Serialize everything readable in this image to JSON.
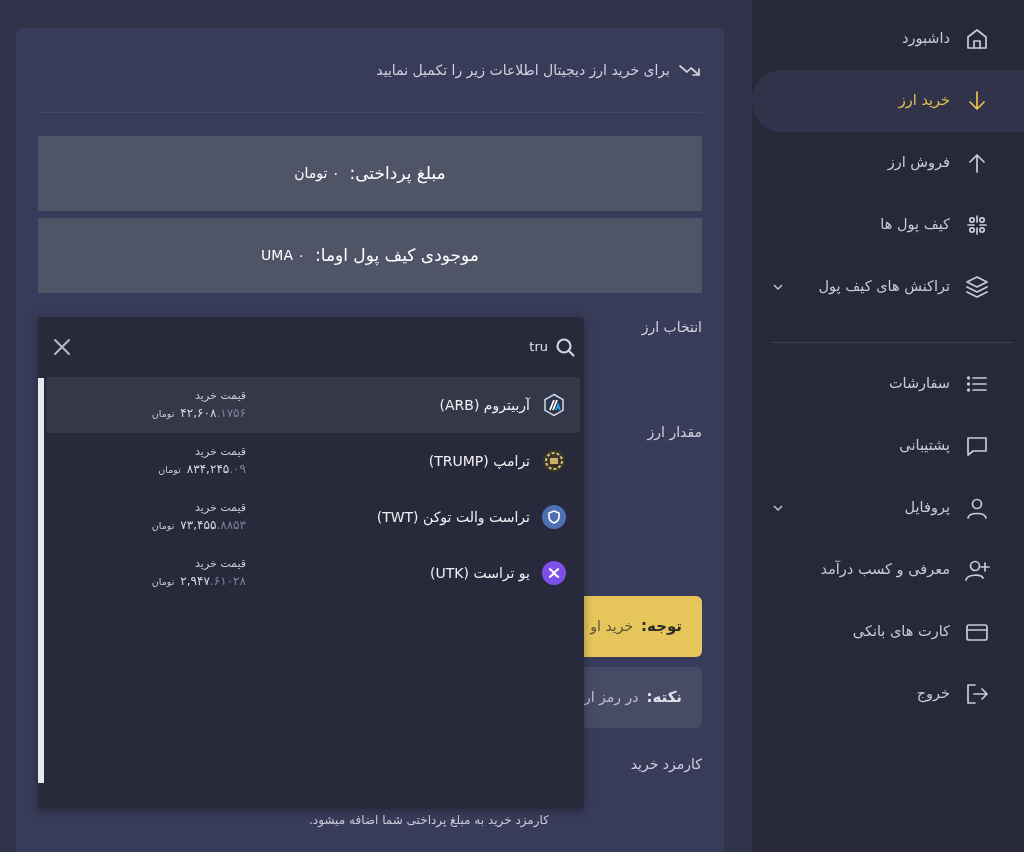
{
  "header": {
    "text": "برای خرید ارز دیجیتال اطلاعات زیر را تکمیل نمایید"
  },
  "summary": [
    {
      "label": "مبلغ پرداختی:",
      "value": "۰ تومان"
    },
    {
      "label": "موجودی کیف پول اوما:",
      "value": "۰ UMA"
    }
  ],
  "form": {
    "currency_label": "انتخاب ارز",
    "amount_label": "مقدار ارز",
    "alerts": [
      {
        "kind": "warning",
        "title": "توجه:",
        "text": "خرید او"
      },
      {
        "kind": "note",
        "title": "نکته:",
        "text": "در رمز ار"
      }
    ],
    "fee_label": "کارمزد خرید",
    "fee_hint": "کارمزد خرید به مبلغ پرداختی شما اضافه میشود."
  },
  "dropdown": {
    "search_value": "tru",
    "items": [
      {
        "name": "آربیتروم (ARB)",
        "price_label": "قیمت خرید",
        "price_int": "۴۲,۶۰۸",
        "price_frac": ".۱۷۵۶",
        "unit": "تومان",
        "selected": true
      },
      {
        "name": "ترامپ (TRUMP)",
        "price_label": "قیمت خرید",
        "price_int": "۸۳۴,۲۴۵",
        "price_frac": ".۰۹",
        "unit": "تومان",
        "selected": false
      },
      {
        "name": "تراست والت توکن (TWT)",
        "price_label": "قیمت خرید",
        "price_int": "۷۳,۴۵۵",
        "price_frac": ".۸۸۵۳",
        "unit": "تومان",
        "selected": false
      },
      {
        "name": "یو تراست (UTK)",
        "price_label": "قیمت خرید",
        "price_int": "۲,۹۴۷",
        "price_frac": ".۶۱۰۲۸",
        "unit": "تومان",
        "selected": false
      }
    ]
  },
  "sidebar": {
    "groups": [
      {
        "items": [
          {
            "label": "داشبورد",
            "selected": false,
            "expandable": false
          },
          {
            "label": "خرید ارز",
            "selected": true,
            "expandable": false
          },
          {
            "label": "فروش ارز",
            "selected": false,
            "expandable": false
          },
          {
            "label": "کیف پول ها",
            "selected": false,
            "expandable": false
          },
          {
            "label": "تراکنش های کیف پول",
            "selected": false,
            "expandable": true
          }
        ]
      },
      {
        "items": [
          {
            "label": "سفارشات",
            "selected": false,
            "expandable": false
          },
          {
            "label": "پشتیبانی",
            "selected": false,
            "expandable": false
          },
          {
            "label": "پروفایل",
            "selected": false,
            "expandable": true
          },
          {
            "label": "معرفی و کسب درآمد",
            "selected": false,
            "expandable": false
          },
          {
            "label": "کارت های بانکی",
            "selected": false,
            "expandable": false
          },
          {
            "label": "خروج",
            "selected": false,
            "expandable": false
          }
        ]
      }
    ]
  }
}
